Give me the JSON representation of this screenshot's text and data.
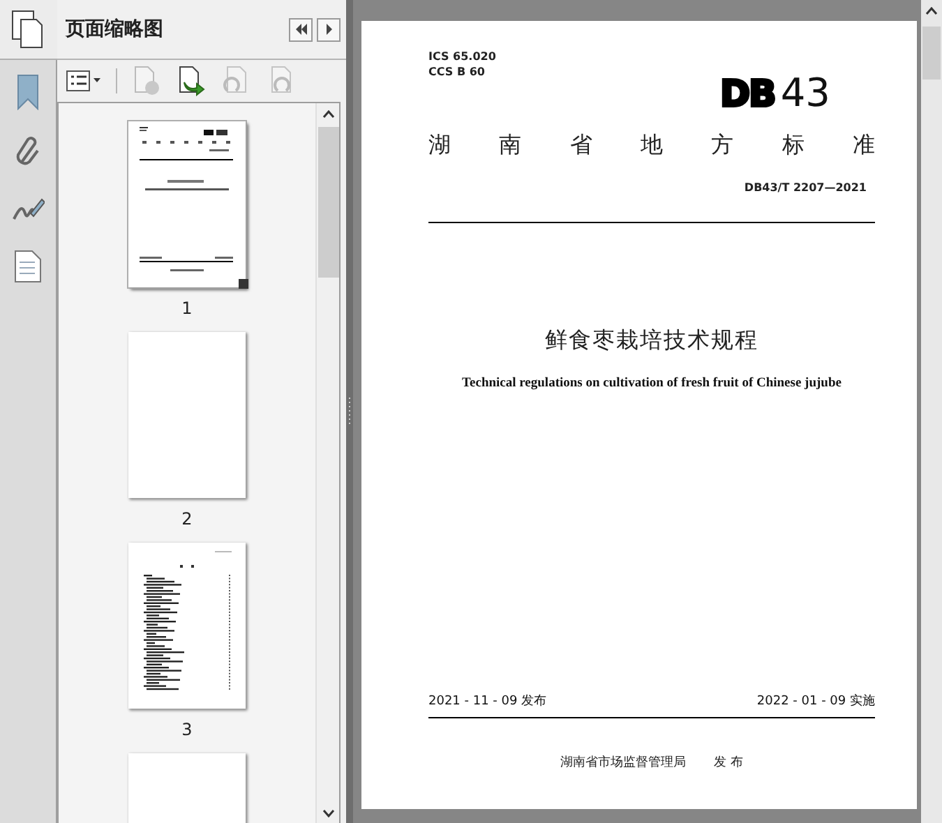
{
  "panel": {
    "title": "页面缩略图"
  },
  "thumbnails": [
    {
      "label": "1",
      "kind": "cover",
      "selected": true
    },
    {
      "label": "2",
      "kind": "blank",
      "selected": false
    },
    {
      "label": "3",
      "kind": "toc",
      "selected": false
    },
    {
      "kind": "blank",
      "selected": false
    }
  ],
  "document": {
    "ics": "ICS 65.020",
    "ccs": "CCS B 60",
    "logo_letters": "DB",
    "logo_number": "43",
    "category": "湖 南 省 地 方 标 准",
    "standard_number": "DB43/T 2207—2021",
    "title": "鲜食枣栽培技术规程",
    "subtitle": "Technical regulations on cultivation of fresh fruit of Chinese jujube",
    "issue_date": "2021 - 11 - 09 发布",
    "effective_date": "2022 - 01 - 09 实施",
    "issuer": "湖南省市场监督管理局",
    "issuer_action": "发 布"
  }
}
